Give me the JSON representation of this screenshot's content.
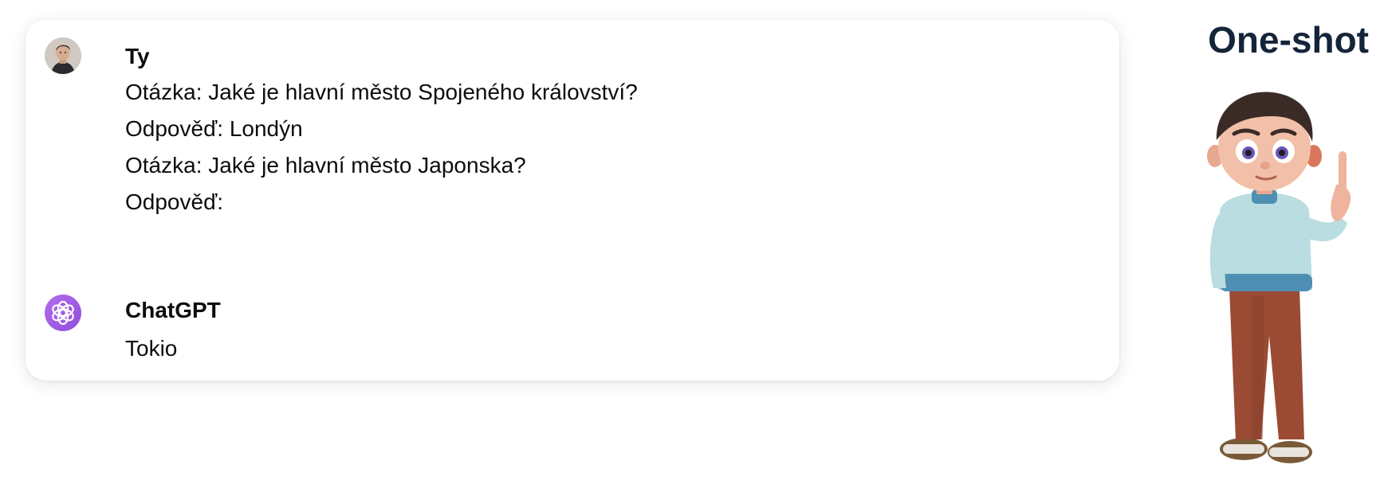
{
  "chat": {
    "user": {
      "name": "Ty",
      "lines": [
        "Otázka: Jaké je hlavní město Spojeného království?",
        "Odpověď: Londýn",
        "Otázka: Jaké je hlavní město Japonska?",
        "Odpověď:"
      ],
      "avatar_icon": "user-photo-avatar"
    },
    "assistant": {
      "name": "ChatGPT",
      "reply": "Tokio",
      "avatar_icon": "openai-logo-icon",
      "avatar_color": "#a35de6"
    }
  },
  "side_panel": {
    "title": "One-shot",
    "title_color": "#14253a",
    "illustration": "cartoon-boy-pointing-up"
  }
}
